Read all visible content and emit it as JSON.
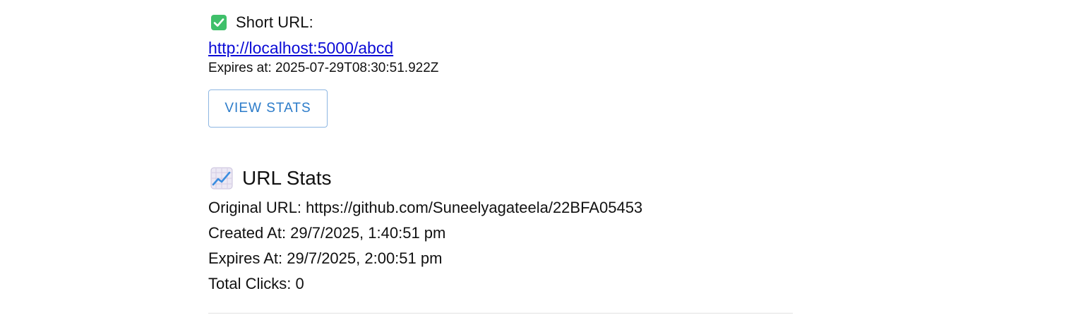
{
  "result": {
    "heading_label": "Short URL:",
    "short_url": "http://localhost:5000/abcd",
    "expires_line": "Expires at: 2025-07-29T08:30:51.922Z",
    "view_stats_label": "VIEW STATS"
  },
  "stats": {
    "heading": "URL Stats",
    "original_url": "Original URL: https://github.com/Suneelyagateela/22BFA05453",
    "created_at": "Created At: 29/7/2025, 1:40:51 pm",
    "expires_at": "Expires At: 29/7/2025, 2:00:51 pm",
    "total_clicks": "Total Clicks: 0"
  },
  "colors": {
    "link": "#0a0ad6",
    "button_text": "#2b7bc9",
    "button_border": "#8db6e2",
    "check_green": "#3fc06a"
  },
  "icons": {
    "heading_result": "check-mark-icon",
    "heading_stats": "chart-increasing-icon"
  }
}
